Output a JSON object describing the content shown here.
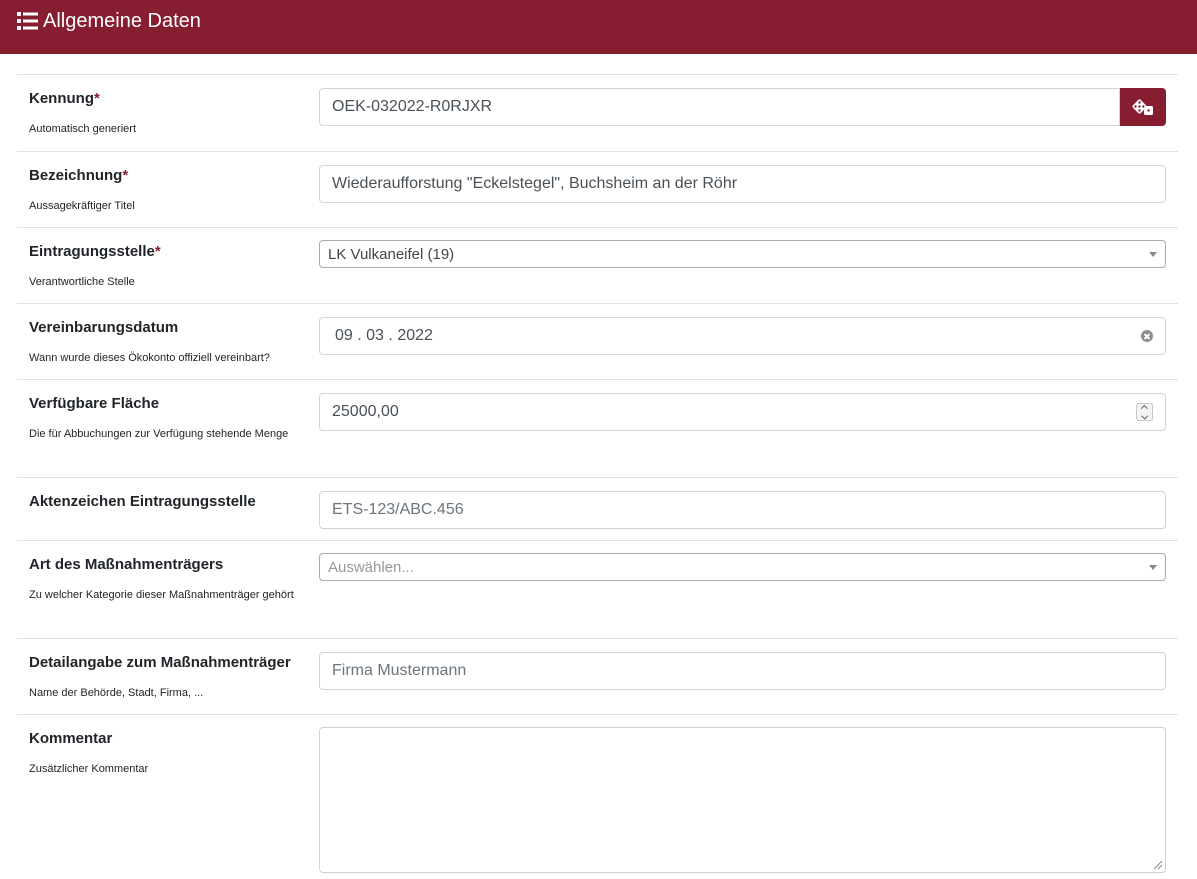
{
  "header": {
    "title": "Allgemeine Daten",
    "icon": "list-icon"
  },
  "colors": {
    "brand": "#861d31",
    "required": "#861d31"
  },
  "fields": [
    {
      "key": "kennung",
      "label": "Kennung",
      "required": "*",
      "help": "Automatisch generiert",
      "value": "OEK-032022-R0RJXR",
      "button_icon": "dice-icon"
    },
    {
      "key": "bezeichnung",
      "label": "Bezeichnung",
      "required": "*",
      "help": "Aussagekräftiger Titel",
      "value": "Wiederaufforstung \"Eckelstegel\", Buchsheim an der Röhr"
    },
    {
      "key": "eintragungsstelle",
      "label": "Eintragungsstelle",
      "required": "*",
      "help": "Verantwortliche Stelle",
      "value": "LK Vulkaneifel (19)"
    },
    {
      "key": "vereinbarungsdatum",
      "label": "Vereinbarungsdatum",
      "help": "Wann wurde dieses Ökokonto offiziell vereinbart?",
      "day": "09",
      "month": "03",
      "year": "2022",
      "sep": "."
    },
    {
      "key": "flaeche",
      "label": "Verfügbare Fläche",
      "help": "Die für Abbuchungen zur Verfügung stehende Menge",
      "value": "25000,00"
    },
    {
      "key": "aktenzeichen",
      "label": "Aktenzeichen Eintragungsstelle",
      "placeholder": "ETS-123/ABC.456"
    },
    {
      "key": "art",
      "label": "Art des Maßnahmenträgers",
      "help": "Zu welcher Kategorie dieser Maßnahmenträger gehört",
      "placeholder": "Auswählen..."
    },
    {
      "key": "detail",
      "label": "Detailangabe zum Maßnahmenträger",
      "help": "Name der Behörde, Stadt, Firma, ...",
      "placeholder": "Firma Mustermann"
    },
    {
      "key": "kommentar",
      "label": "Kommentar",
      "help": "Zusätzlicher Kommentar",
      "value": ""
    }
  ]
}
